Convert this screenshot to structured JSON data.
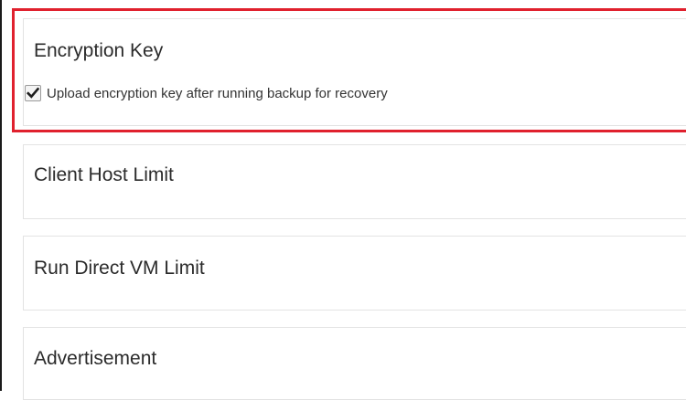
{
  "sections": {
    "encryption": {
      "title": "Encryption Key",
      "checkbox_label": "Upload encryption key after running backup for recovery",
      "checked": true
    },
    "client_host": {
      "title": "Client Host Limit"
    },
    "run_direct": {
      "title": "Run Direct VM Limit"
    },
    "advertisement": {
      "title": "Advertisement"
    }
  },
  "colors": {
    "highlight": "#e0212e",
    "panel_border": "#e3e3e3"
  },
  "icons": {
    "checkbox": "checkmark-icon"
  }
}
